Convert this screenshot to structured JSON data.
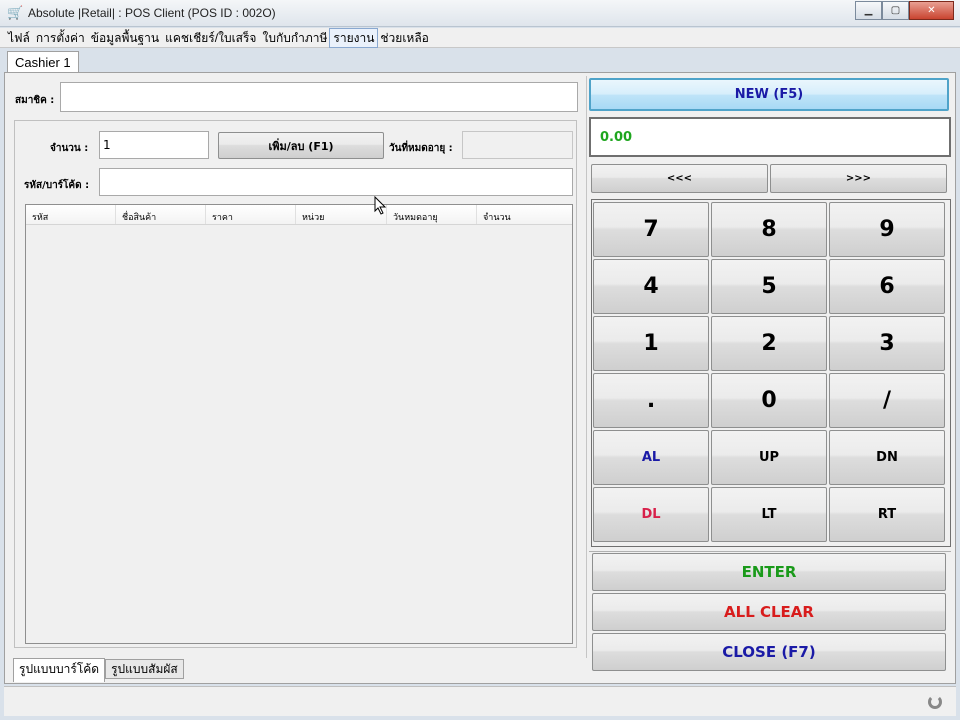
{
  "window": {
    "title": "Absolute |Retail| : POS Client (POS ID : 002O)",
    "app_icon": "cart-icon"
  },
  "menu": [
    "ไฟล์",
    "การตั้งค่า",
    "ข้อมูลพื้นฐาน",
    "แคชเชียร์/ใบเสร็จ",
    "ใบกับกำภาษี",
    "รายงาน",
    "ช่วยเหลือ"
  ],
  "tab_top": "Cashier 1",
  "member": {
    "label": "สมาชิค :",
    "value": ""
  },
  "qty": {
    "label": "จำนวน :",
    "value": "1"
  },
  "add_remove_button": "เพิ่ม/ลบ (F1)",
  "expiry": {
    "label": "วันที่หมดอายุ :",
    "value": ""
  },
  "barcode": {
    "label": "รหัส/บาร์โค้ด :",
    "value": ""
  },
  "table": {
    "headers": [
      "รหัส",
      "ชื่อสินค้า",
      "ราคา",
      "หน่วย",
      "วันหมดอายุ",
      "จำนวน"
    ]
  },
  "bottom_tabs": [
    "รูปแบบบาร์โค้ด",
    "รูปแบบสัมผัส"
  ],
  "new_button": "NEW (F5)",
  "display_value": "0.00",
  "nav": {
    "prev": "<<<",
    "next": ">>>"
  },
  "keys": [
    "7",
    "8",
    "9",
    "4",
    "5",
    "6",
    "1",
    "2",
    "3",
    ".",
    "0",
    "/",
    "AL",
    "UP",
    "DN",
    "DL",
    "LT",
    "RT"
  ],
  "actions": {
    "enter": "ENTER",
    "clear": "ALL CLEAR",
    "close": "CLOSE (F7)"
  },
  "colors": {
    "blue": "#1a1aa6",
    "green": "#1a9a1a",
    "red": "#d81c1c",
    "crimson": "#d8204a"
  }
}
